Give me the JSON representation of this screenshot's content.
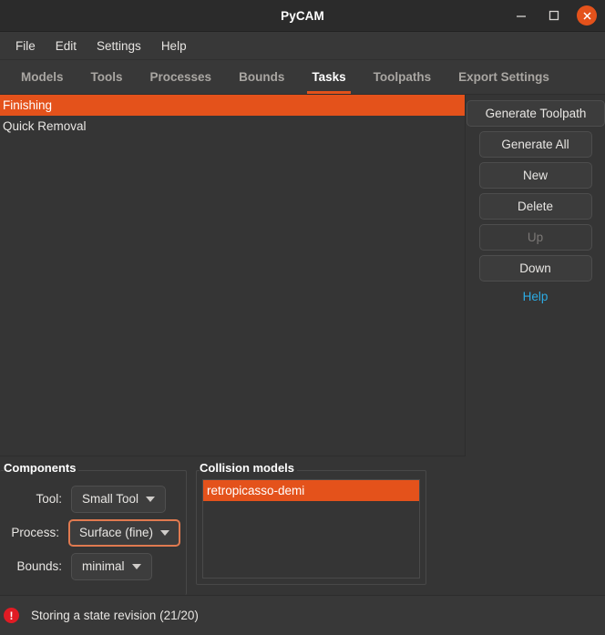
{
  "window": {
    "title": "PyCAM",
    "controls": {
      "minimize": "minimize-icon",
      "maximize": "maximize-icon",
      "close": "close-icon"
    }
  },
  "menubar": {
    "items": [
      {
        "label": "File"
      },
      {
        "label": "Edit"
      },
      {
        "label": "Settings"
      },
      {
        "label": "Help"
      }
    ]
  },
  "tabs": {
    "active": "Tasks",
    "items": [
      {
        "label": "Models"
      },
      {
        "label": "Tools"
      },
      {
        "label": "Processes"
      },
      {
        "label": "Bounds"
      },
      {
        "label": "Tasks"
      },
      {
        "label": "Toolpaths"
      },
      {
        "label": "Export Settings"
      }
    ]
  },
  "task_list": {
    "rows": [
      {
        "label": "Finishing",
        "selected": true
      },
      {
        "label": "Quick Removal",
        "selected": false
      }
    ]
  },
  "side_panel": {
    "buttons": [
      {
        "label": "Generate Toolpath",
        "enabled": true
      },
      {
        "label": "Generate All",
        "enabled": true
      },
      {
        "label": "New",
        "enabled": true
      },
      {
        "label": "Delete",
        "enabled": true
      },
      {
        "label": "Up",
        "enabled": false
      },
      {
        "label": "Down",
        "enabled": true
      }
    ],
    "help_label": "Help"
  },
  "components": {
    "title": "Components",
    "rows": [
      {
        "label": "Tool:",
        "value": "Small Tool",
        "focused": false
      },
      {
        "label": "Process:",
        "value": "Surface (fine)",
        "focused": true
      },
      {
        "label": "Bounds:",
        "value": "minimal",
        "focused": false
      }
    ]
  },
  "collision_models": {
    "title": "Collision models",
    "rows": [
      {
        "label": "retropicasso-demi",
        "selected": true
      }
    ]
  },
  "statusbar": {
    "icon": "error-icon",
    "icon_glyph": "!",
    "message": "Storing a state revision (21/20)"
  },
  "colors": {
    "accent_orange": "#e4521b",
    "link_blue": "#2cabe3",
    "error_red": "#e01b24",
    "titlebar_bg": "#2b2b2b",
    "window_bg": "#353535",
    "panel_bg": "#383838"
  }
}
